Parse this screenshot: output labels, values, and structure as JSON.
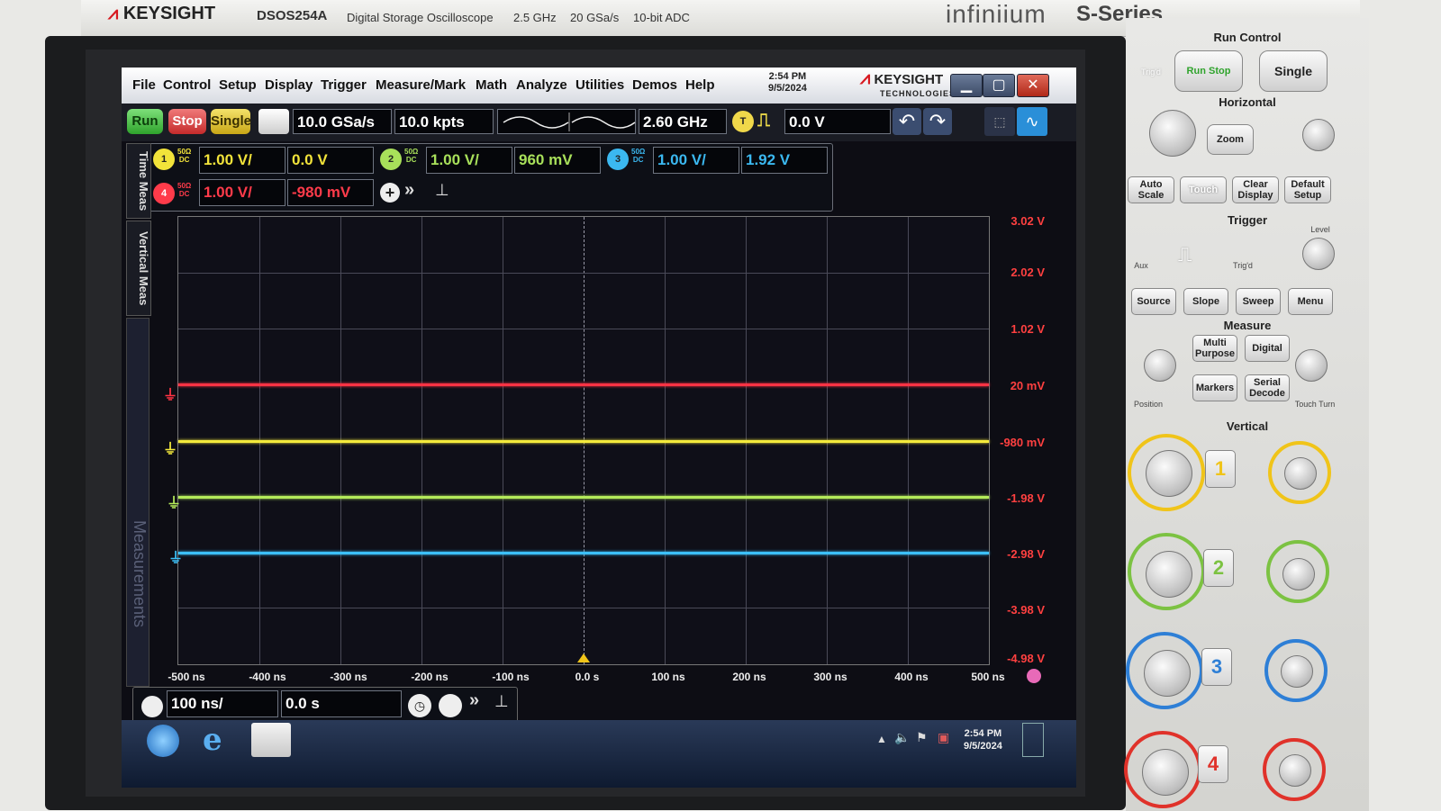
{
  "bezel": {
    "brand": "KEYSIGHT",
    "model": "DSOS254A",
    "description": "Digital Storage Oscilloscope",
    "bandwidth": "2.5 GHz",
    "sample_rate": "20 GSa/s",
    "adc": "10-bit ADC",
    "product_line": "infiniium",
    "series": "S-Series"
  },
  "menubar": {
    "items": [
      "File",
      "Control",
      "Setup",
      "Display",
      "Trigger",
      "Measure/Mark",
      "Math",
      "Analyze",
      "Utilities",
      "Demos",
      "Help"
    ],
    "time": "2:54 PM",
    "date": "9/5/2024",
    "logo_main": "KEYSIGHT",
    "logo_sub": "TECHNOLOGIES"
  },
  "toolbar": {
    "run_label": "Run",
    "stop_label": "Stop",
    "single_label": "Single",
    "sample_rate": "10.0 GSa/s",
    "memory_depth": "10.0 kpts",
    "bandwidth": "2.60 GHz",
    "trigger_source": "T",
    "trigger_level": "0.0 V"
  },
  "channels": [
    {
      "num": "1",
      "coupling": "50Ω",
      "dc": "DC",
      "scale": "1.00 V/",
      "offset": "0.0 V",
      "color": "#f2e33a"
    },
    {
      "num": "2",
      "coupling": "50Ω",
      "dc": "DC",
      "scale": "1.00 V/",
      "offset": "960 mV",
      "color": "#a8e05a"
    },
    {
      "num": "3",
      "coupling": "50Ω",
      "dc": "DC",
      "scale": "1.00 V/",
      "offset": "1.92 V",
      "color": "#3bb8f0"
    },
    {
      "num": "4",
      "coupling": "50Ω",
      "dc": "DC",
      "scale": "1.00 V/",
      "offset": "-980 mV",
      "color": "#ff3b4a"
    }
  ],
  "side_tabs": {
    "time_meas": "Time Meas",
    "vertical_meas": "Vertical Meas",
    "measurements": "Measurements"
  },
  "y_axis": [
    "3.02 V",
    "2.02 V",
    "1.02 V",
    "20 mV",
    "-980 mV",
    "-1.98 V",
    "-2.98 V",
    "-3.98 V",
    "-4.98 V"
  ],
  "x_axis": [
    "-500 ns",
    "-400 ns",
    "-300 ns",
    "-200 ns",
    "-100 ns",
    "0.0 s",
    "100 ns",
    "200 ns",
    "300 ns",
    "400 ns",
    "500 ns"
  ],
  "traces": [
    {
      "name": "ch4",
      "color": "#ff3344",
      "level_v": 0.02
    },
    {
      "name": "ch1",
      "color": "#f4ea3c",
      "level_v": -0.98
    },
    {
      "name": "ch2",
      "color": "#b4ea5a",
      "level_v": -1.98
    },
    {
      "name": "ch3",
      "color": "#3cc0f8",
      "level_v": -2.98
    }
  ],
  "horizontal": {
    "scale": "100 ns/",
    "position": "0.0 s"
  },
  "taskbar": {
    "time": "2:54 PM",
    "date": "9/5/2024"
  },
  "panel": {
    "run_control": "Run Control",
    "run_stop": "Run Stop",
    "single": "Single",
    "horizontal": "Horizontal",
    "zoom": "Zoom",
    "auto_scale": "Auto Scale",
    "touch": "Touch",
    "clear_display": "Clear Display",
    "default_setup": "Default Setup",
    "trigger": "Trigger",
    "source": "Source",
    "slope": "Slope",
    "sweep": "Sweep",
    "menu": "Menu",
    "measure": "Measure",
    "multi_purpose": "Multi Purpose",
    "digital": "Digital",
    "markers": "Markers",
    "serial_decode": "Serial Decode",
    "vertical": "Vertical",
    "position": "Position",
    "touch_turn": "Touch Turn",
    "aux": "Aux",
    "trigd": "Trig'd",
    "level": "Level",
    "ch_buttons": [
      "1",
      "2",
      "3",
      "4"
    ],
    "ch_colors": [
      "#f0c419",
      "#7cc242",
      "#2e7fd6",
      "#e0322a"
    ]
  }
}
